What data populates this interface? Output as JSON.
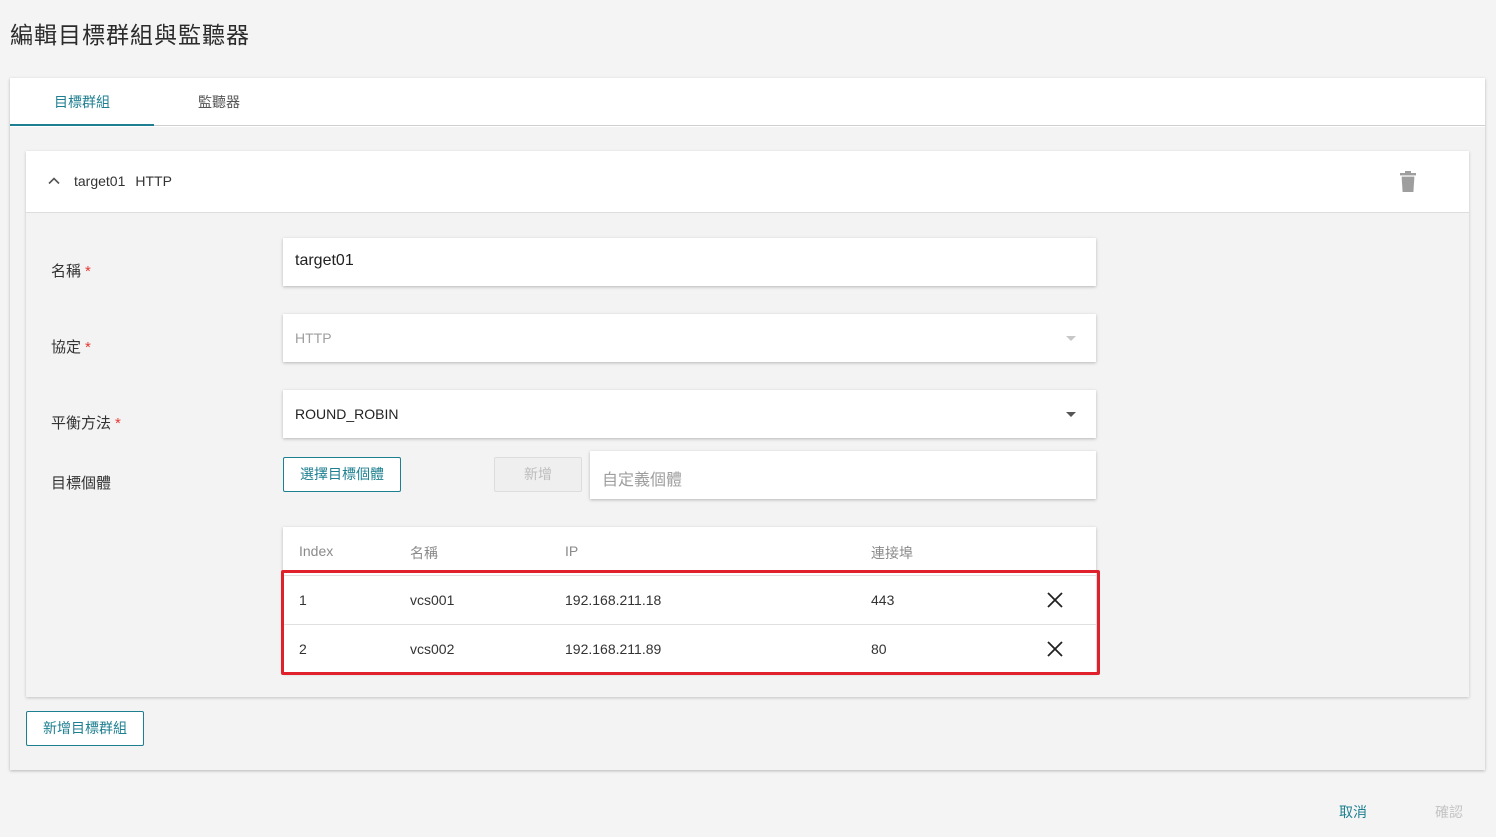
{
  "page": {
    "title": "編輯目標群組與監聽器"
  },
  "tabs": [
    {
      "label": "目標群組",
      "active": true
    },
    {
      "label": "監聽器",
      "active": false
    }
  ],
  "group": {
    "name": "target01",
    "protocol": "HTTP",
    "form": {
      "name_label": "名稱",
      "name_value": "target01",
      "protocol_label": "協定",
      "protocol_value": "HTTP",
      "balance_label": "平衡方法",
      "balance_value": "ROUND_ROBIN",
      "targets_label": "目標個體",
      "required_mark": "*",
      "select_targets_button": "選擇目標個體",
      "add_button": "新增",
      "custom_target_placeholder": "自定義個體"
    },
    "table": {
      "headers": [
        "Index",
        "名稱",
        "IP",
        "連接埠"
      ],
      "rows": [
        {
          "index": "1",
          "name": "vcs001",
          "ip": "192.168.211.18",
          "port": "443"
        },
        {
          "index": "2",
          "name": "vcs002",
          "ip": "192.168.211.89",
          "port": "80"
        }
      ]
    }
  },
  "add_group_button": "新增目標群組",
  "footer": {
    "cancel": "取消",
    "confirm": "確認"
  },
  "colors": {
    "accent": "#1d7f90",
    "required": "#e53935",
    "highlight": "#e0202a"
  },
  "icons": [
    "chevron-up-icon",
    "trash-icon",
    "dropdown-caret-icon",
    "close-icon"
  ]
}
